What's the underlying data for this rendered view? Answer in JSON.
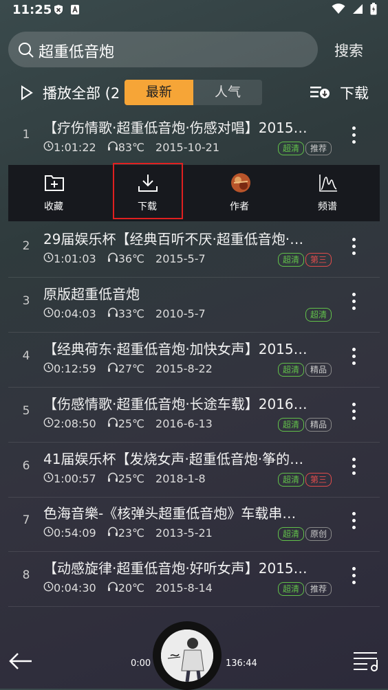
{
  "status": {
    "time": "11:25"
  },
  "search": {
    "query": "超重低音炮",
    "button": "搜索"
  },
  "toolbar": {
    "play_all": "播放全部 (2",
    "tab_new": "最新",
    "tab_hot": "人气",
    "download": "下载"
  },
  "actions": [
    {
      "label": "收藏",
      "icon": "add-folder-icon"
    },
    {
      "label": "下载",
      "icon": "download-icon"
    },
    {
      "label": "作者",
      "icon": "author-avatar-icon"
    },
    {
      "label": "频谱",
      "icon": "spectrum-icon"
    }
  ],
  "songs": [
    {
      "num": "1",
      "title": "【疗伤情歌·超重低音炮·伤感对唱】2015…",
      "duration": "1:01:22",
      "heat": "83℃",
      "date": "2015-10-21",
      "tags": [
        "超清",
        "推荐"
      ]
    },
    {
      "num": "2",
      "title": "29届娱乐杯【经典百听不厌·超重低音炮·…",
      "duration": "1:01:03",
      "heat": "36℃",
      "date": "2015-5-7",
      "tags": [
        "超清",
        "第三"
      ]
    },
    {
      "num": "3",
      "title": "原版超重低音炮",
      "duration": "0:04:03",
      "heat": "33℃",
      "date": "2010-5-7",
      "tags": [
        "超清"
      ]
    },
    {
      "num": "4",
      "title": "【经典荷东·超重低音炮·加快女声】2015…",
      "duration": "0:12:59",
      "heat": "27℃",
      "date": "2015-8-22",
      "tags": [
        "超清",
        "精品"
      ]
    },
    {
      "num": "5",
      "title": "【伤感情歌·超重低音炮·长途车载】2016…",
      "duration": "2:08:50",
      "heat": "25℃",
      "date": "2016-6-13",
      "tags": [
        "超清",
        "精品"
      ]
    },
    {
      "num": "6",
      "title": "41届娱乐杯【发烧女声·超重低音炮·筝的…",
      "duration": "1:00:57",
      "heat": "25℃",
      "date": "2018-1-8",
      "tags": [
        "超清",
        "第三"
      ]
    },
    {
      "num": "7",
      "title": "色海音樂-《核弹头超重低音炮》车载串…",
      "duration": "0:54:09",
      "heat": "23℃",
      "date": "2013-5-21",
      "tags": [
        "超清",
        "原创"
      ]
    },
    {
      "num": "8",
      "title": "【动感旋律·超重低音炮·好听女声】2015…",
      "duration": "0:04:30",
      "heat": "20℃",
      "date": "2015-8-14",
      "tags": [
        "超清",
        "推荐"
      ]
    }
  ],
  "player": {
    "elapsed": "0:00",
    "total": "136:44"
  },
  "colors": {
    "accent": "#f6a537",
    "tag_green": "#62c24a",
    "tag_red": "#e24c4c",
    "highlight": "#e12020"
  }
}
